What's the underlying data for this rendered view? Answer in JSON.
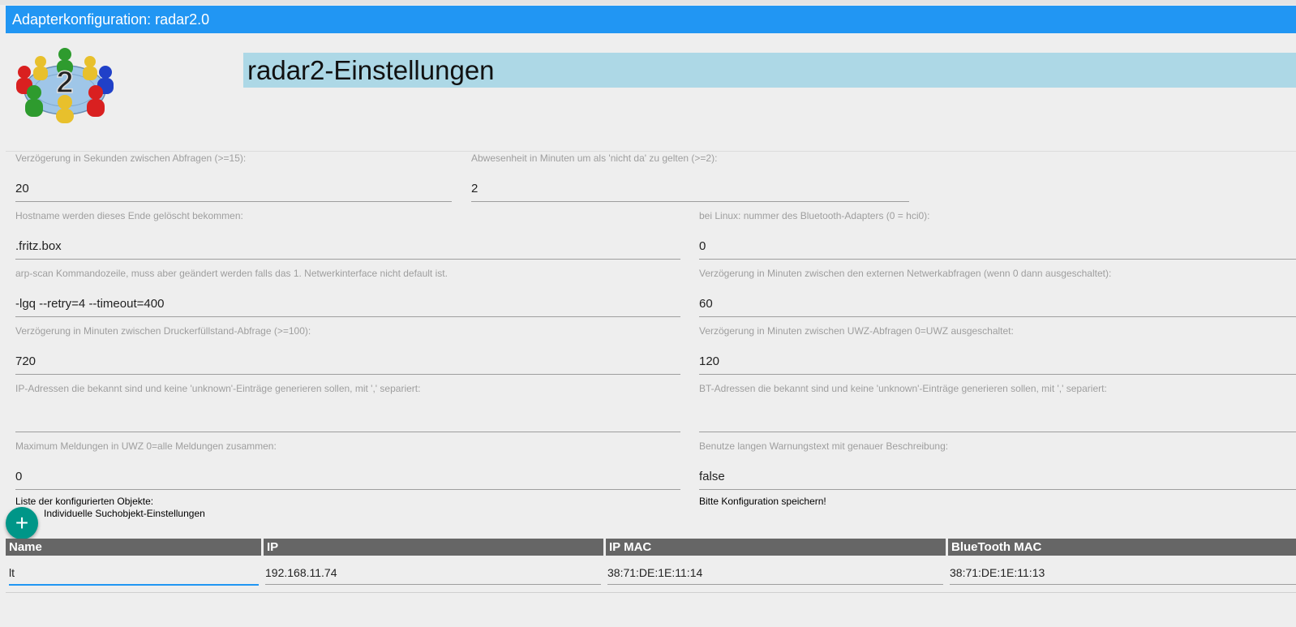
{
  "window": {
    "title": "Adapterkonfiguration: radar2.0"
  },
  "header": {
    "logo_digit": "2",
    "title": "radar2-Einstellungen"
  },
  "fields": {
    "delay_seconds": {
      "label": "Verzögerung in Sekunden zwischen Abfragen (>=15):",
      "value": "20"
    },
    "absence_minutes": {
      "label": "Abwesenheit in Minuten um als 'nicht da' zu gelten (>=2):",
      "value": "2"
    },
    "hostname_suffix": {
      "label": "Hostname werden dieses Ende gelöscht bekommen:",
      "value": ".fritz.box"
    },
    "bt_adapter": {
      "label": "bei Linux: nummer des Bluetooth-Adapters (0 = hci0):",
      "value": "0"
    },
    "arp_scan": {
      "label": "arp-scan Kommandozeile, muss aber geändert werden falls das 1. Netwerkinterface nicht default ist.",
      "value": "-lgq --retry=4 --timeout=400"
    },
    "external_delay": {
      "label": "Verzögerung in Minuten zwischen den externen Netwerkabfragen (wenn 0 dann ausgeschaltet):",
      "value": "60"
    },
    "printer_delay": {
      "label": "Verzögerung in Minuten zwischen Druckerfüllstand-Abfrage (>=100):",
      "value": "720"
    },
    "uwz_delay": {
      "label": "Verzögerung in Minuten zwischen UWZ-Abfragen 0=UWZ ausgeschaltet:",
      "value": "120"
    },
    "known_ips": {
      "label": "IP-Adressen die bekannt sind und keine 'unknown'-Einträge generieren sollen, mit ',' separiert:",
      "value": ""
    },
    "known_bts": {
      "label": "BT-Adressen die bekannt sind und keine 'unknown'-Einträge generieren sollen, mit ',' separiert:",
      "value": ""
    },
    "max_uwz": {
      "label": "Maximum Meldungen in UWZ 0=alle Meldungen zusammen:",
      "value": "0"
    },
    "long_warning": {
      "label": "Benutze langen Warnungstext mit genauer Beschreibung:",
      "value": "false"
    }
  },
  "objects": {
    "list_label": "Liste der konfigurierten Objekte:",
    "individual_label": "Individuelle Suchobjekt-Einstellungen",
    "save_hint": "Bitte Konfiguration speichern!",
    "add_icon": "+",
    "columns": [
      "Name",
      "IP",
      "IP MAC",
      "BlueTooth MAC"
    ],
    "rows": [
      {
        "name": "lt",
        "ip": "192.168.11.74",
        "ip_mac": "38:71:DE:1E:11:14",
        "bt_mac": "38:71:DE:1E:11:13"
      }
    ]
  },
  "colors": {
    "titlebar": "#2196f3",
    "header_bg": "#add8e6",
    "add_button": "#009688",
    "table_header": "#666666"
  }
}
